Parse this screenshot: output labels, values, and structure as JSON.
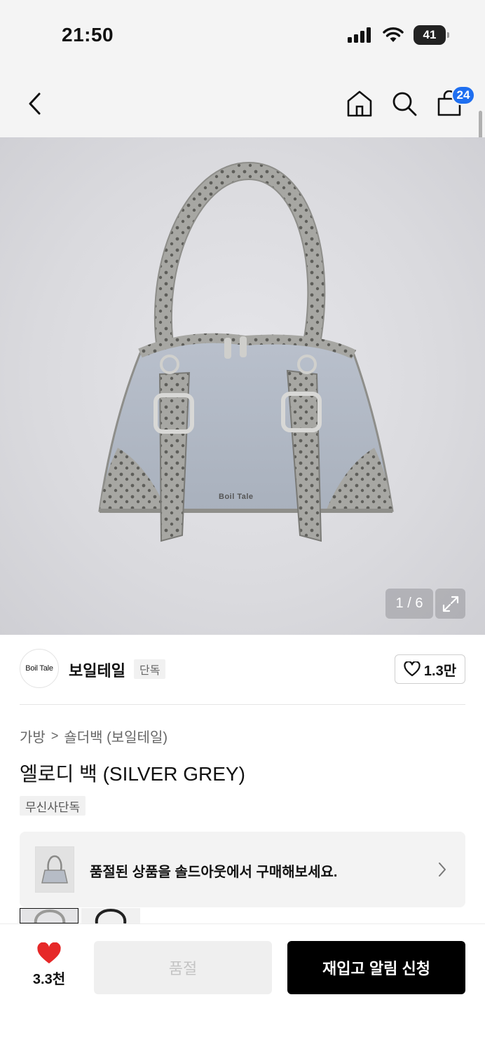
{
  "status_bar": {
    "time": "21:50",
    "battery": "41"
  },
  "nav": {
    "cart_count": "24"
  },
  "gallery": {
    "counter": "1 / 6",
    "logo_text": "Boil Tale"
  },
  "brand": {
    "logo_text": "Boil Tale",
    "name": "보일테일",
    "exclusive_tag": "단독",
    "likes": "1.3만"
  },
  "breadcrumb": {
    "category": "가방",
    "separator": ">",
    "subcategory": "숄더백 (보일테일)"
  },
  "product": {
    "title": "엘로디 백 (SILVER GREY)",
    "tag": "무신사단독"
  },
  "soldout_banner": {
    "text": "품절된 상품을 솔드아웃에서 구매해보세요."
  },
  "bottom": {
    "wish_count": "3.3천",
    "soldout_label": "품절",
    "restock_label": "재입고 알림 신청"
  },
  "colors": {
    "accent_blue": "#1f6ff0",
    "heart_red": "#e62828",
    "primary_black": "#000000"
  },
  "icons": [
    "back-chevron-icon",
    "home-icon",
    "search-icon",
    "cart-icon",
    "expand-icon",
    "heart-outline-icon",
    "chevron-right-icon",
    "heart-filled-icon",
    "signal-icon",
    "wifi-icon",
    "battery-icon"
  ]
}
